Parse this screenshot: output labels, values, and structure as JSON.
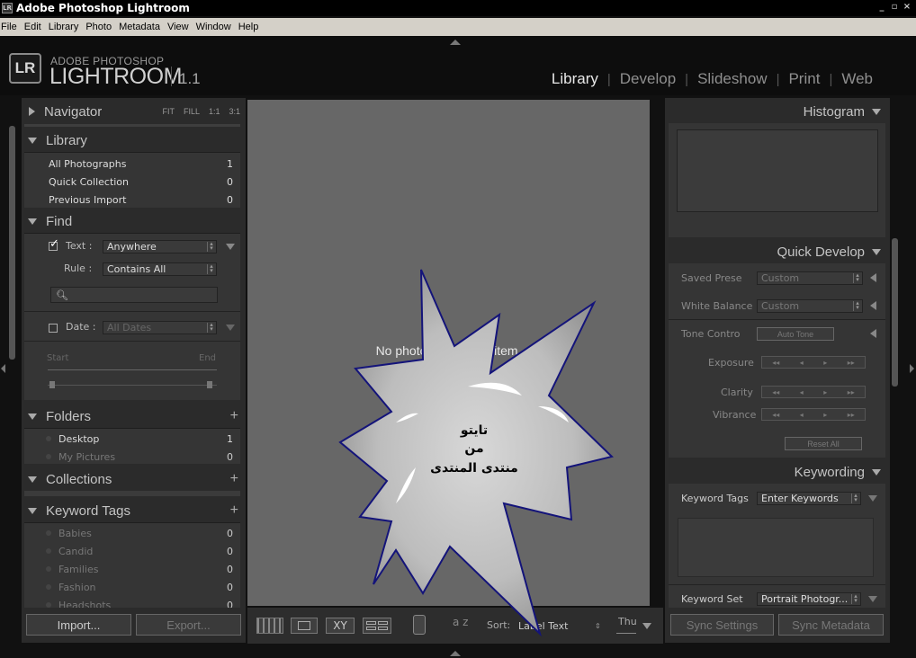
{
  "window": {
    "title": "Adobe Photoshop Lightroom",
    "app_icon": "LR",
    "controls": [
      "_",
      "▫",
      "×"
    ]
  },
  "menu": [
    "File",
    "Edit",
    "Library",
    "Photo",
    "Metadata",
    "View",
    "Window",
    "Help"
  ],
  "brand": {
    "badge": "LR",
    "top": "ADOBE PHOTOSHOP",
    "main": "LIGHTROOM",
    "version": "1.1"
  },
  "modules": [
    {
      "label": "Library",
      "active": true
    },
    {
      "label": "Develop",
      "active": false
    },
    {
      "label": "Slideshow",
      "active": false
    },
    {
      "label": "Print",
      "active": false
    },
    {
      "label": "Web",
      "active": false
    }
  ],
  "left": {
    "navigator": {
      "title": "Navigator",
      "zoom": [
        "FIT",
        "FILL",
        "1:1",
        "3:1"
      ]
    },
    "library": {
      "title": "Library",
      "items": [
        {
          "label": "All Photographs",
          "count": "1"
        },
        {
          "label": "Quick Collection",
          "count": "0"
        },
        {
          "label": "Previous Import",
          "count": "0"
        }
      ]
    },
    "find": {
      "title": "Find",
      "text_label": "Text :",
      "text_value": "Anywhere",
      "rule_label": "Rule :",
      "rule_value": "Contains All",
      "date_label": "Date :",
      "date_value": "All Dates",
      "start_label": "Start",
      "end_label": "End"
    },
    "folders": {
      "title": "Folders",
      "items": [
        {
          "label": "Desktop",
          "count": "1"
        },
        {
          "label": "My Pictures",
          "count": "0"
        }
      ]
    },
    "collections": {
      "title": "Collections"
    },
    "keywords": {
      "title": "Keyword Tags",
      "items": [
        {
          "label": "Babies",
          "count": "0"
        },
        {
          "label": "Candid",
          "count": "0"
        },
        {
          "label": "Families",
          "count": "0"
        },
        {
          "label": "Fashion",
          "count": "0"
        },
        {
          "label": "Headshots",
          "count": "0"
        }
      ]
    },
    "import_label": "Import...",
    "export_label": "Export..."
  },
  "center": {
    "message": "No photo in selected item."
  },
  "right": {
    "histogram": {
      "title": "Histogram"
    },
    "quick_develop": {
      "title": "Quick Develop",
      "saved_preset_label": "Saved Prese",
      "saved_preset_value": "Custom",
      "white_balance_label": "White Balance",
      "white_balance_value": "Custom",
      "tone_label": "Tone Contro",
      "auto_tone": "Auto Tone",
      "exposure_label": "Exposure",
      "clarity_label": "Clarity",
      "vibrance_label": "Vibrance",
      "reset_label": "Reset All"
    },
    "keywording": {
      "title": "Keywording",
      "tags_label": "Keyword Tags",
      "tags_value": "Enter Keywords",
      "set_label": "Keyword Set",
      "set_value": "Portrait Photogr..."
    },
    "sync_settings": "Sync Settings",
    "sync_metadata": "Sync Metadata"
  },
  "toolbar": {
    "sort_label": "Sort:",
    "sort_value": "Label Text",
    "thumb_label": "Thu",
    "sort_icon_text": "a z"
  },
  "overlay": {
    "line1": "تايتو",
    "line2": "من",
    "line3": "منتدى المنتدى"
  },
  "colors": {
    "panel": "#2b2b2b",
    "center": "#676767",
    "accent_text": "#e8e8e8",
    "overlay_stroke": "#1a1a80"
  }
}
